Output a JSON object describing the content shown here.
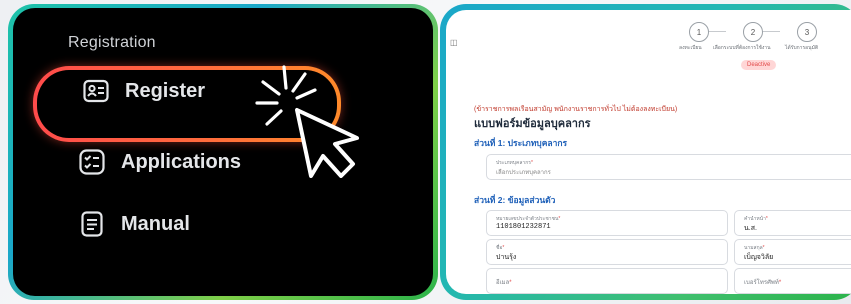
{
  "left_panel": {
    "heading": "Registration",
    "menu": [
      {
        "label": "Register",
        "icon": "id-card-icon"
      },
      {
        "label": "Applications",
        "icon": "checklist-icon"
      },
      {
        "label": "Manual",
        "icon": "document-icon"
      }
    ],
    "highlight_color": "#ff5a3c"
  },
  "right_panel": {
    "steps": [
      {
        "number": "1",
        "label": "ลงทะเบียน"
      },
      {
        "number": "2",
        "label": "เลือกระบบที่ต้องการใช้งาน"
      },
      {
        "number": "3",
        "label": "ได้รับการอนุมัติ"
      }
    ],
    "status_badge": "Deactive",
    "hint": "(ข้าราชการพลเรือนสามัญ พนักงานราชการทั่วไป ไม่ต้องลงทะเบียน)",
    "form_title": "แบบฟอร์มข้อมูลบุคลากร",
    "section1_title": "ส่วนที่ 1: ประเภทบุคลากร",
    "personnel_type": {
      "label": "ประเภทบุคลากร",
      "required_mark": "*",
      "placeholder": "เลือกประเภทบุคลากร"
    },
    "section2_title": "ส่วนที่ 2: ข้อมูลส่วนตัว",
    "id_number": {
      "label": "หมายเลขประจำตัวประชาชน",
      "required_mark": "*",
      "value": "1101801232871"
    },
    "prefix": {
      "label": "คำนำหน้า",
      "required_mark": "*",
      "value": "น.ส."
    },
    "first_name": {
      "label": "ชื่อ",
      "required_mark": "*",
      "value": "ปานรุ้ง"
    },
    "last_name": {
      "label": "นามสกุล",
      "required_mark": "*",
      "value": "เบ็ญจวิลัย"
    },
    "email": {
      "label": "อีเมล",
      "required_mark": "*"
    },
    "phone": {
      "label": "เบอร์โทรศัพท์",
      "required_mark": "*"
    },
    "accent_color": "#1d5fb8"
  }
}
